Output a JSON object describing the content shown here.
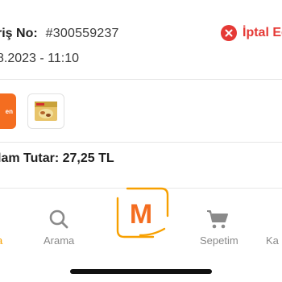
{
  "order": {
    "number_label": "riş No:",
    "number_value": "#300559237",
    "date": "8.2023 - 11:10",
    "status_label": "İptal Ed",
    "status_color": "#e53935",
    "thumb_badge": "en",
    "total": "lam Tutar: 27,25 TL"
  },
  "tabbar": {
    "home_label": "a",
    "search_label": "Arama",
    "center_letter": "M",
    "cart_label": "Sepetim",
    "account_label": "Ka",
    "accent_color": "#f7a000",
    "inactive_color": "#8a8a8a"
  },
  "icons": [
    "close-circle-icon",
    "product-thumbnail",
    "search-icon",
    "migros-m-logo-icon",
    "cart-icon"
  ]
}
